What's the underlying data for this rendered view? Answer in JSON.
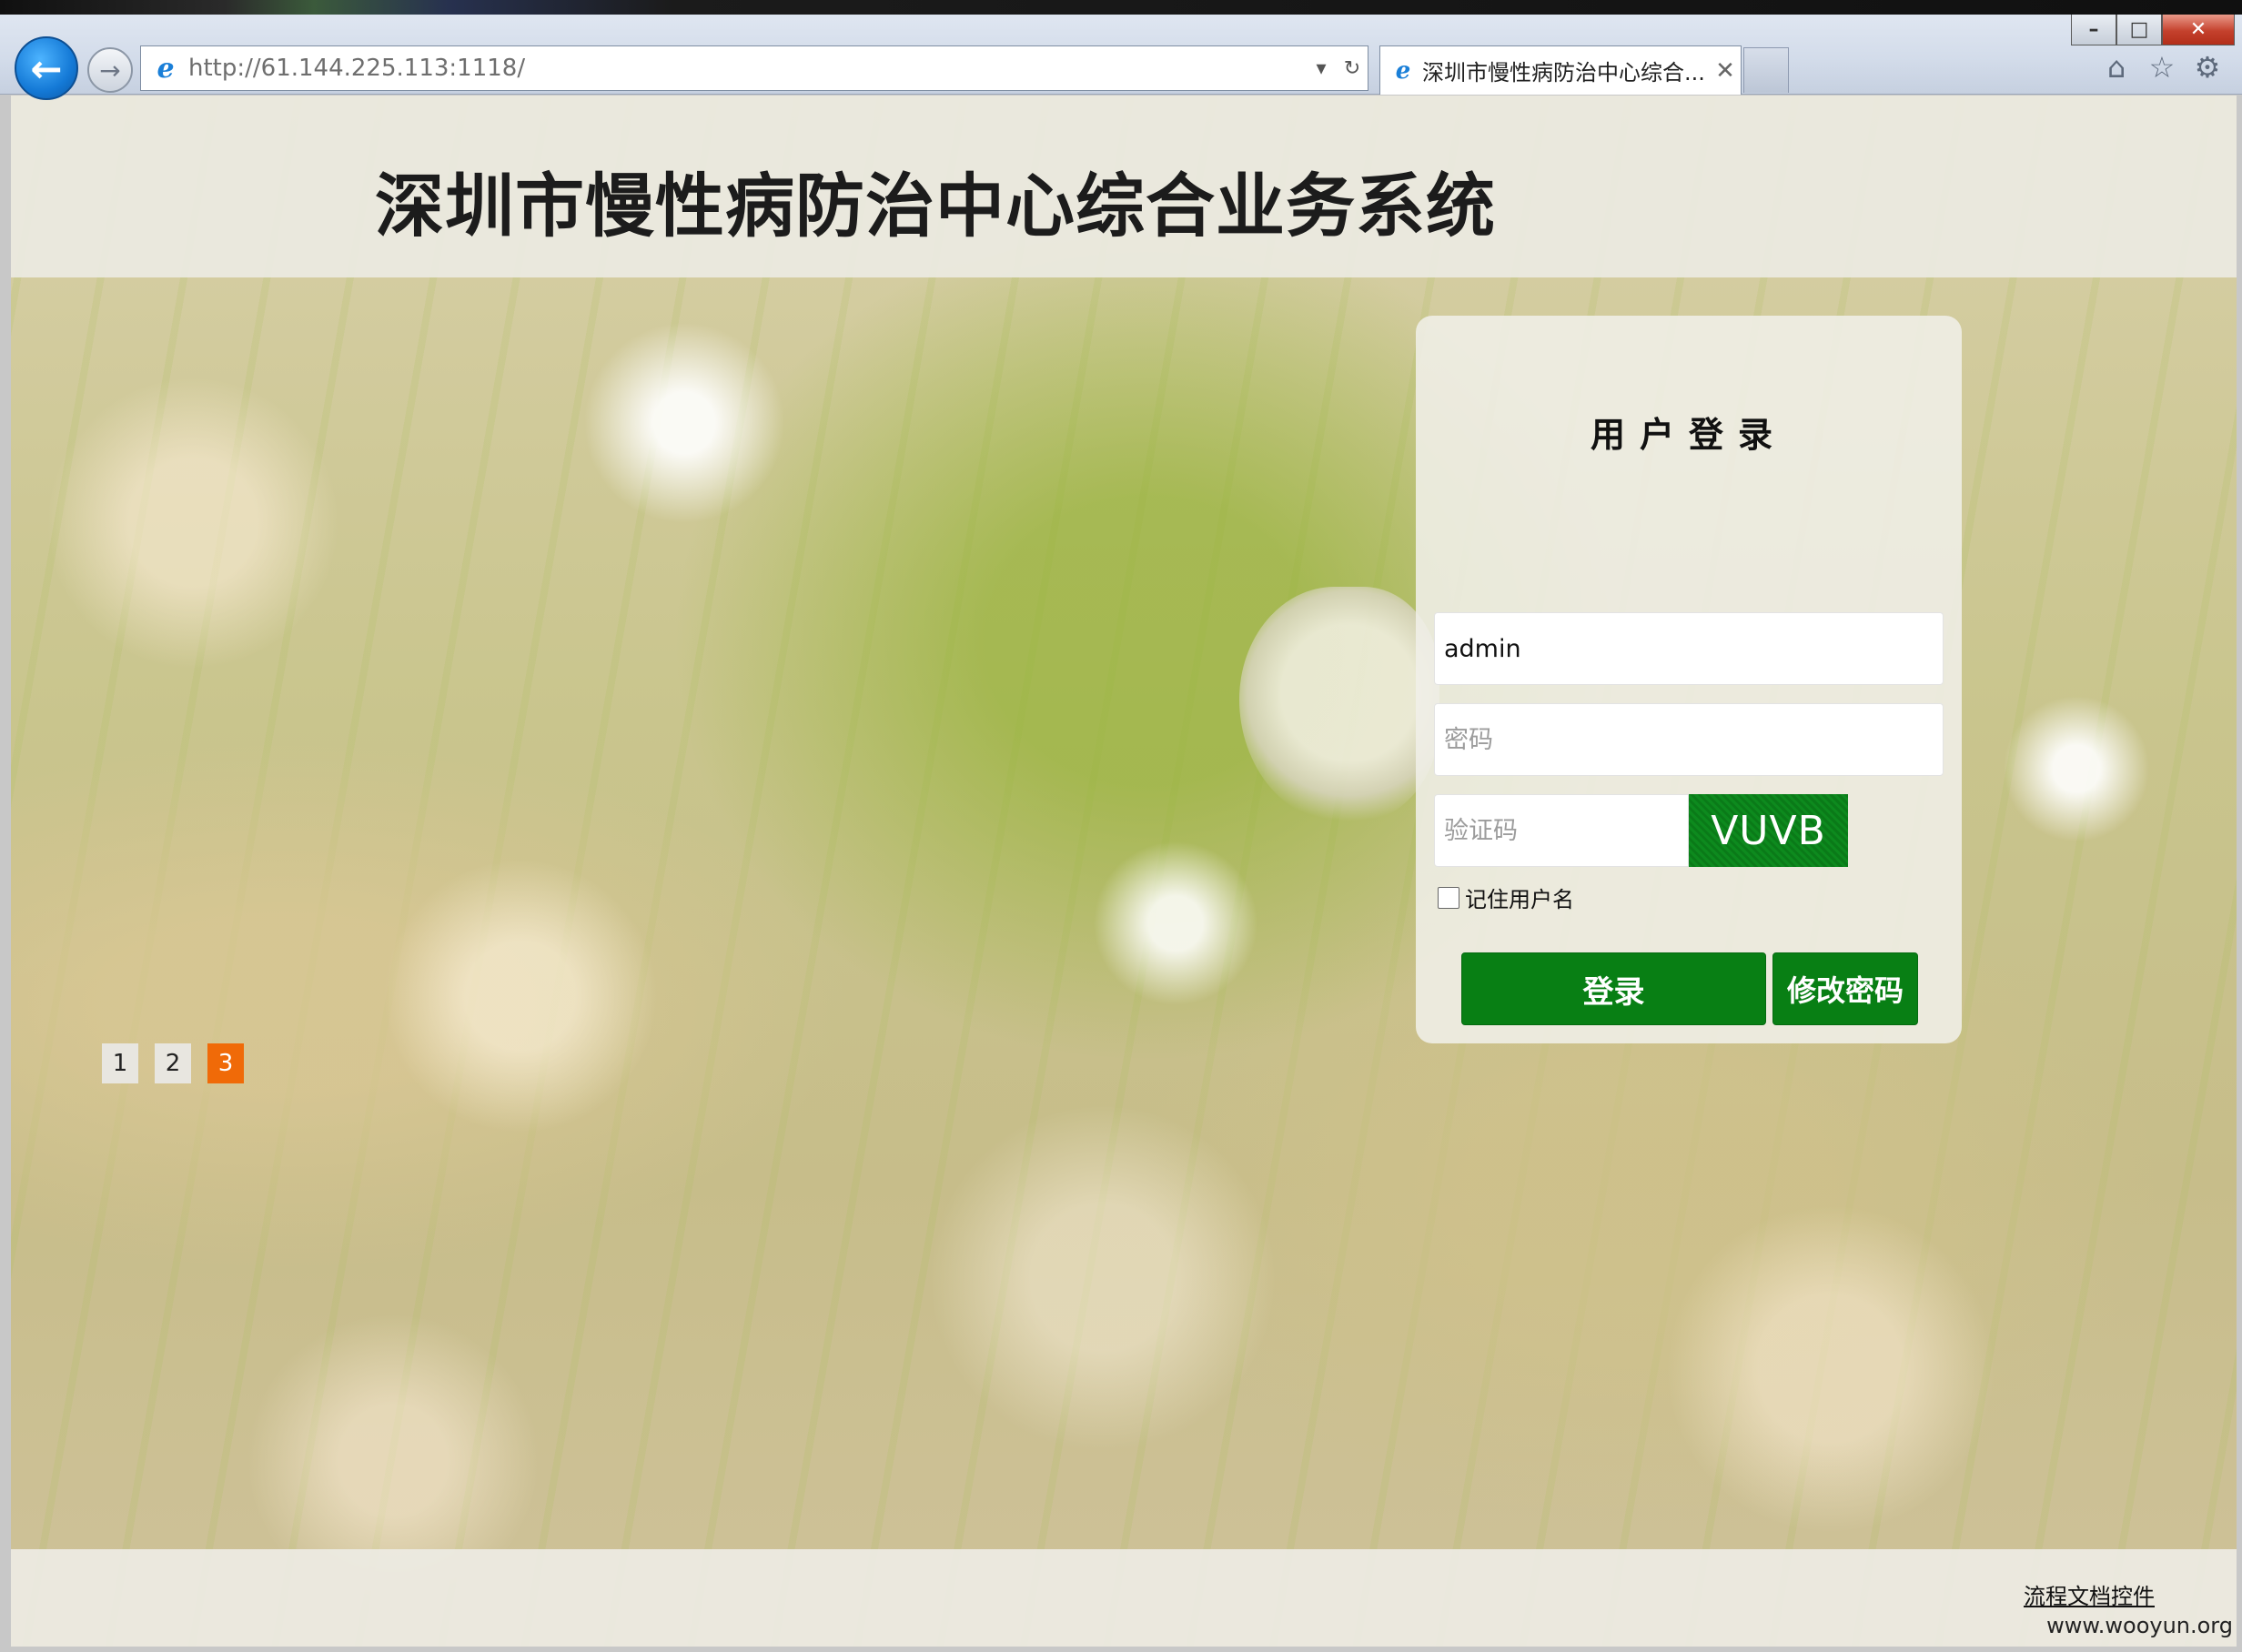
{
  "browser": {
    "url": "http://61.144.225.113:1118/",
    "tab_title": "深圳市慢性病防治中心综合...",
    "window_controls": [
      "–",
      "□",
      "✕"
    ]
  },
  "header": {
    "title": "深圳市慢性病防治中心综合业务系统"
  },
  "login": {
    "title": "用户登录",
    "username_value": "admin",
    "password_placeholder": "密码",
    "captcha_placeholder": "验证码",
    "captcha_text": "VUVB",
    "remember_label": "记住用户名",
    "remember_checked": false,
    "login_button": "登录",
    "change_password_button": "修改密码"
  },
  "pager": {
    "pages": [
      "1",
      "2",
      "3"
    ],
    "active": "3"
  },
  "footer": {
    "link": "流程文档控件",
    "watermark": "www.wooyun.org"
  },
  "icons": {
    "back": "arrow-left-icon",
    "forward": "arrow-right-icon",
    "refresh": "refresh-icon",
    "home": "home-icon",
    "favorites": "star-icon",
    "tools": "gear-icon"
  },
  "colors": {
    "primary_green": "#087f14",
    "active_page": "#f06a08"
  }
}
